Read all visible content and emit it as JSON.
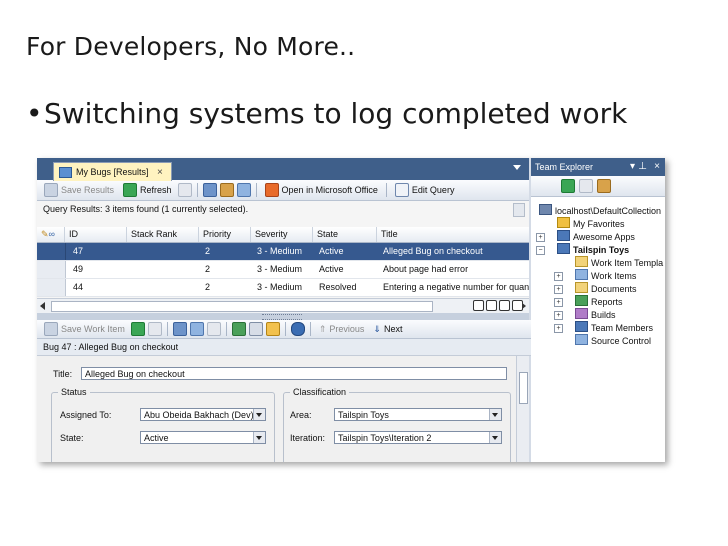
{
  "slide": {
    "title": "For Developers, No More..",
    "bullet": "Switching systems to log completed work"
  },
  "document": {
    "tab_label": "My Bugs [Results]",
    "toolbar": {
      "save_results": "Save Results",
      "refresh": "Refresh",
      "open_office": "Open in Microsoft Office",
      "edit_query": "Edit Query"
    },
    "query_results": "Query Results: 3 items found (1 currently selected).",
    "columns": [
      "ID",
      "Stack Rank",
      "Priority",
      "Severity",
      "State",
      "Title"
    ],
    "rows": [
      {
        "id": "47",
        "stack_rank": "",
        "priority": "2",
        "severity": "3 - Medium",
        "state": "Active",
        "title": "Alleged Bug on checkout",
        "selected": true
      },
      {
        "id": "49",
        "stack_rank": "",
        "priority": "2",
        "severity": "3 - Medium",
        "state": "Active",
        "title": "About page had error",
        "selected": false
      },
      {
        "id": "44",
        "stack_rank": "",
        "priority": "2",
        "severity": "3 - Medium",
        "state": "Resolved",
        "title": "Entering a negative number for quan",
        "selected": false
      }
    ],
    "work_item_toolbar": {
      "save_work_item": "Save Work Item",
      "previous": "Previous",
      "next": "Next"
    },
    "bug_header": "Bug 47 : Alleged Bug on checkout",
    "form": {
      "title_label": "Title:",
      "title_value": "Alleged Bug on checkout",
      "status_group": "Status",
      "assigned_to_label": "Assigned To:",
      "assigned_to_value": "Abu Obeida Bakhach (Dev)",
      "state_label": "State:",
      "state_value": "Active",
      "classification_group": "Classification",
      "area_label": "Area:",
      "area_value": "Tailspin Toys",
      "iteration_label": "Iteration:",
      "iteration_value": "Tailspin Toys\\Iteration 2"
    }
  },
  "team_explorer": {
    "title": "Team Explorer",
    "tree": [
      {
        "label": "localhost\\DefaultCollection",
        "level": 0,
        "icon": "server-icon",
        "bold": false
      },
      {
        "label": "My Favorites",
        "level": 1,
        "icon": "favorites-icon",
        "bold": false
      },
      {
        "label": "Awesome Apps",
        "level": 1,
        "icon": "project-icon",
        "bold": false
      },
      {
        "label": "Tailspin Toys",
        "level": 1,
        "icon": "project-icon",
        "bold": true
      },
      {
        "label": "Work Item Templa",
        "level": 2,
        "icon": "folder-icon",
        "bold": false
      },
      {
        "label": "Work Items",
        "level": 2,
        "icon": "work-items-icon",
        "bold": false
      },
      {
        "label": "Documents",
        "level": 2,
        "icon": "documents-icon",
        "bold": false
      },
      {
        "label": "Reports",
        "level": 2,
        "icon": "reports-icon",
        "bold": false
      },
      {
        "label": "Builds",
        "level": 2,
        "icon": "builds-icon",
        "bold": false
      },
      {
        "label": "Team Members",
        "level": 2,
        "icon": "team-members-icon",
        "bold": false
      },
      {
        "label": "Source Control",
        "level": 2,
        "icon": "source-control-icon",
        "bold": false
      }
    ]
  },
  "colors": {
    "titlebar": "#3f5f8a",
    "selection": "#36598f",
    "tab_active": "#fff3c0"
  }
}
